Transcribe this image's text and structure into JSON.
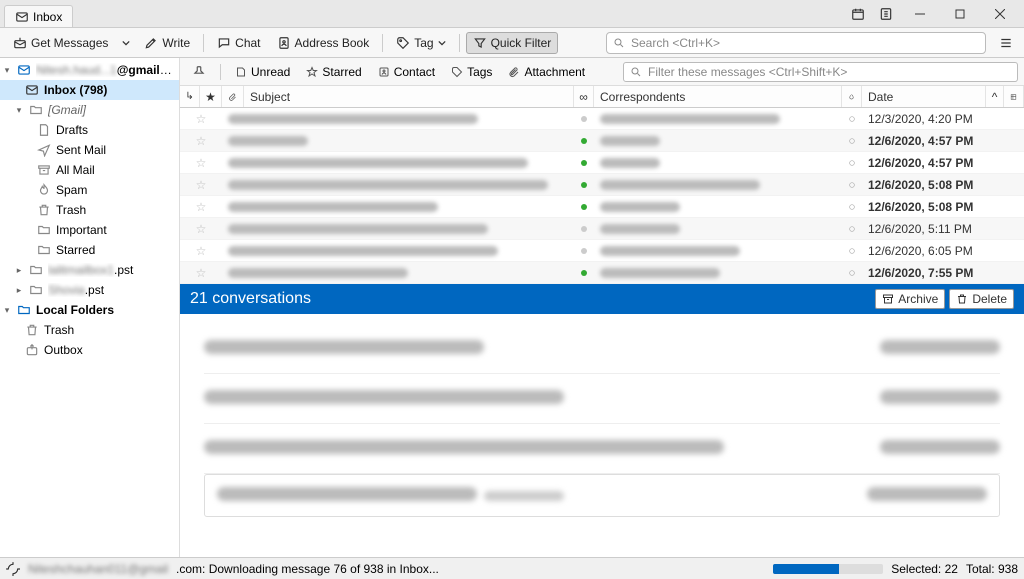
{
  "titlebar": {
    "tab": "Inbox"
  },
  "toolbar": {
    "get_messages": "Get Messages",
    "write": "Write",
    "chat": "Chat",
    "address_book": "Address Book",
    "tag": "Tag",
    "quick_filter": "Quick Filter",
    "search_placeholder": "Search <Ctrl+K>"
  },
  "sidebar": {
    "account_blur": "██████████ @gmail.com",
    "inbox": "Inbox (798)",
    "gmail": "[Gmail]",
    "drafts": "Drafts",
    "sent": "Sent Mail",
    "all": "All Mail",
    "spam": "Spam",
    "trash": "Trash",
    "important": "Important",
    "starred": "Starred",
    "pst1": "██████.pst",
    "pst2": "████.pst",
    "local": "Local Folders",
    "ltrash": "Trash",
    "outbox": "Outbox"
  },
  "filterbar": {
    "unread": "Unread",
    "starred": "Starred",
    "contact": "Contact",
    "tags": "Tags",
    "attachment": "Attachment",
    "filter_placeholder": "Filter these messages <Ctrl+Shift+K>"
  },
  "columns": {
    "subject": "Subject",
    "correspondents": "Correspondents",
    "date": "Date"
  },
  "messages": [
    {
      "bold": false,
      "date": "12/3/2020, 4:20 PM"
    },
    {
      "bold": true,
      "date": "12/6/2020, 4:57 PM"
    },
    {
      "bold": true,
      "date": "12/6/2020, 4:57 PM"
    },
    {
      "bold": true,
      "date": "12/6/2020, 5:08 PM"
    },
    {
      "bold": true,
      "date": "12/6/2020, 5:08 PM"
    },
    {
      "bold": false,
      "date": "12/6/2020, 5:11 PM"
    },
    {
      "bold": false,
      "date": "12/6/2020, 6:05 PM"
    },
    {
      "bold": true,
      "date": "12/6/2020, 7:55 PM"
    }
  ],
  "conv": {
    "title": "21 conversations",
    "archive": "Archive",
    "delete": "Delete"
  },
  "status": {
    "text": ".com: Downloading message 76 of 938 in Inbox...",
    "selected": "Selected: 22",
    "total": "Total: 938"
  }
}
